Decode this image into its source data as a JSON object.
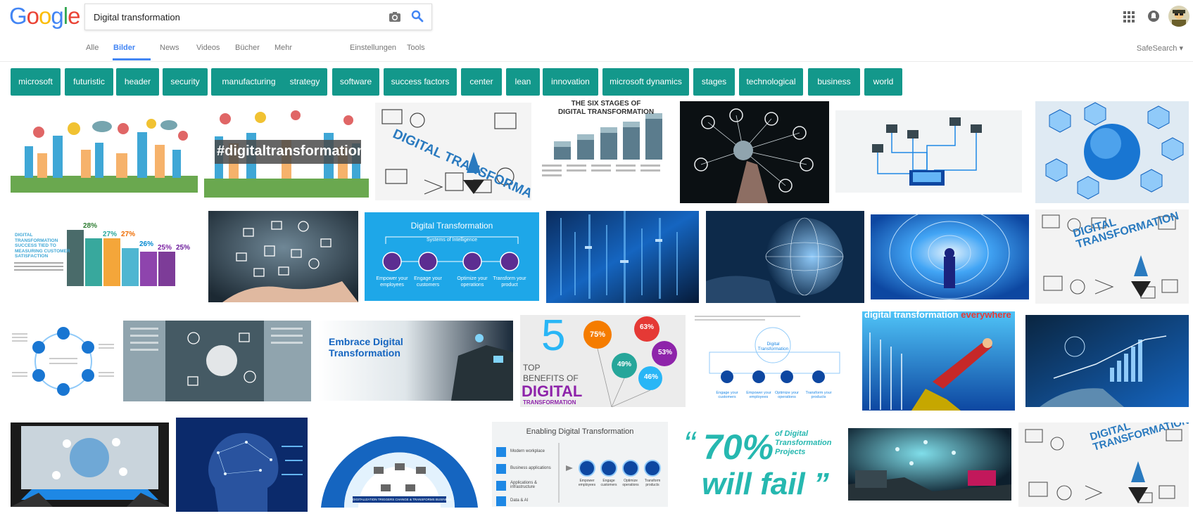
{
  "search": {
    "query": "Digital transformation"
  },
  "logo": {
    "letters": [
      "G",
      "o",
      "o",
      "g",
      "l",
      "e"
    ]
  },
  "colors": {
    "blue": "#4285f4",
    "red": "#ea4335",
    "yellow": "#fbbc05",
    "green": "#34a853",
    "chip": "#13988b"
  },
  "tabs": [
    "Alle",
    "Bilder",
    "News",
    "Videos",
    "Bücher",
    "Mehr",
    "Einstellungen",
    "Tools"
  ],
  "safesearch": "SafeSearch",
  "chips": [
    "microsoft",
    "futuristic",
    "header",
    "security",
    "manufacturing",
    "strategy",
    "software",
    "success factors",
    "center",
    "lean",
    "innovation",
    "microsoft dynamics",
    "stages",
    "technological",
    "business",
    "world"
  ],
  "images": {
    "hashtag": "#digitaltransformation",
    "digital_transformation_upper": "DIGITAL TRANSFORMATION",
    "six_stages": [
      "THE SIX STAGES OF",
      "DIGITAL TRANSFORMATION"
    ],
    "success_tied": [
      "DIGITAL",
      "TRANSFORMATION",
      "SUCCESS TIED TO",
      "MEASURING CUSTOMER",
      "SATISFACTION"
    ],
    "success_values": [
      "28%",
      "27%",
      "27%",
      "26%",
      "25%",
      "25%"
    ],
    "ms_title": "Digital Transformation",
    "ms_subtitle": "Systems of Intelligence",
    "ms_labels": [
      "Empower your employees",
      "Engage your customers",
      "Optimize your operations",
      "Transform your product"
    ],
    "embrace": [
      "Embrace Digital",
      "Transformation"
    ],
    "top5": {
      "number": "5",
      "line1": "TOP",
      "line2": "BENEFITS OF",
      "line3": "DIGITAL",
      "line4": "TRANSFORMATION",
      "stats": [
        "75%",
        "63%",
        "53%",
        "49%",
        "46%"
      ]
    },
    "everywhere": [
      "digital transformation ",
      "everywhere"
    ],
    "ms_small_title": "Digital Transformation",
    "ms_small_labels": [
      "Engage your customers",
      "Empower your employees",
      "Optimize your operations",
      "Transform your products"
    ],
    "triggers": "DIGITALIZATION TRIGGERS CHANGE & TRANSFORMS BUSINESS",
    "enabling_title": "Enabling Digital Transformation",
    "enabling_items": [
      "Modern workplace",
      "Business applications",
      "Applications & infrastructure",
      "Data & AI"
    ],
    "enabling_labels": [
      "Empower employees",
      "Engage customers",
      "Optimize operations",
      "Transform products"
    ],
    "fail": {
      "big": "70%",
      "line1": "of Digital",
      "line2": "Transformation",
      "line3": "Projects",
      "line4": "will fail"
    }
  }
}
